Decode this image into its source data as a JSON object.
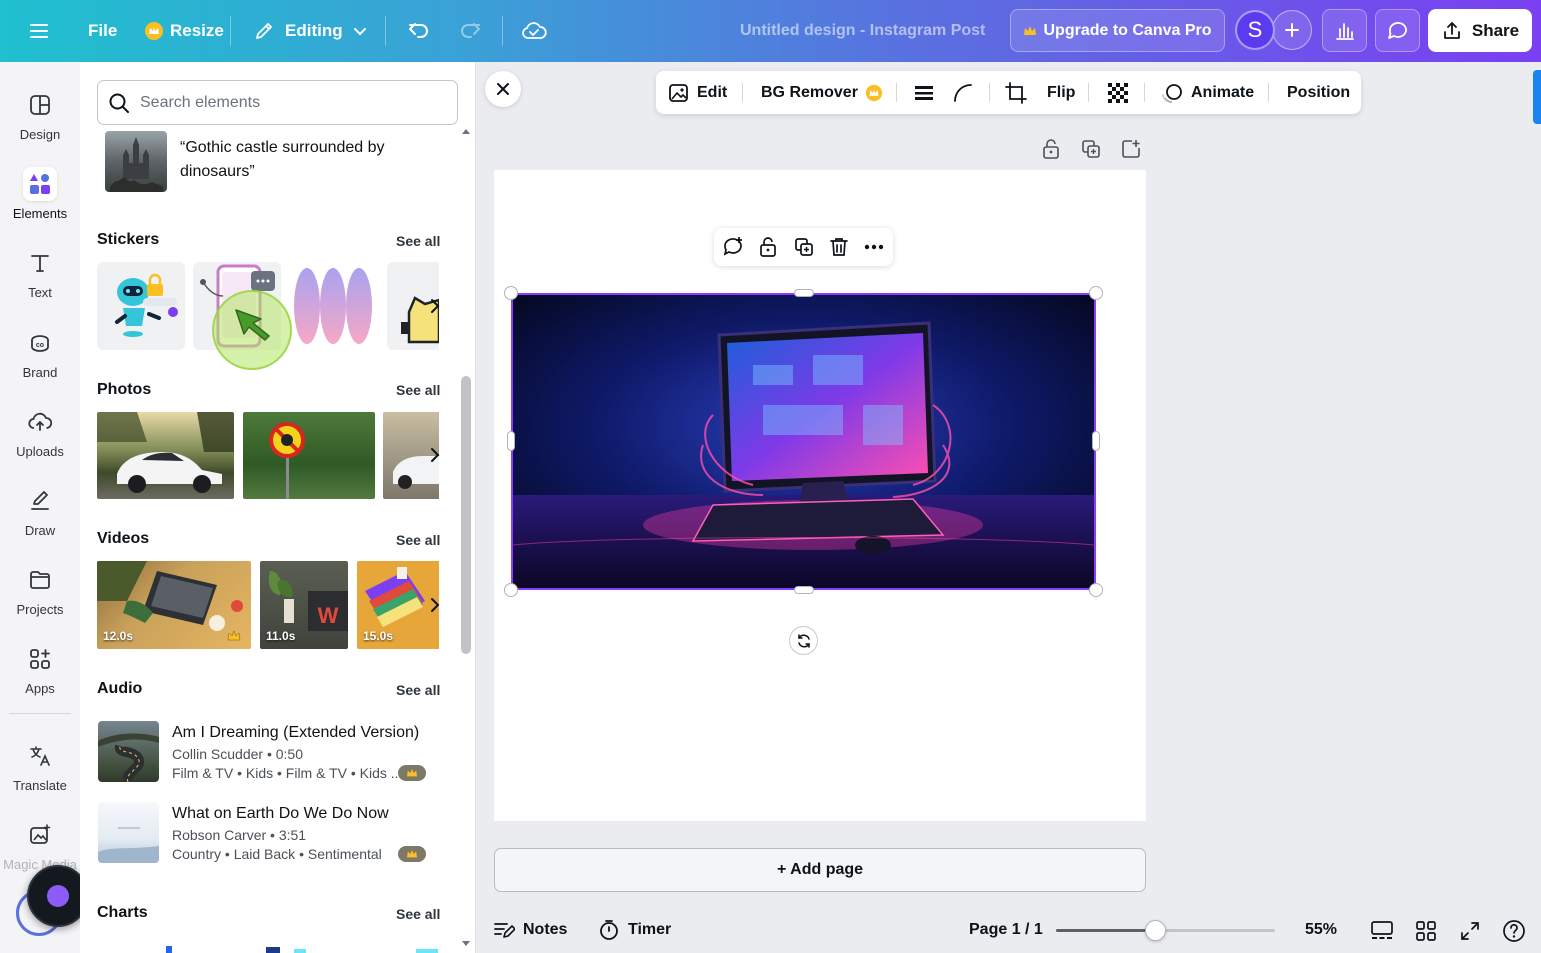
{
  "topbar": {
    "file_label": "File",
    "resize_label": "Resize",
    "editing_label": "Editing",
    "doc_title": "Untitled design - Instagram Post",
    "upgrade_label": "Upgrade to Canva Pro",
    "avatar_initial": "S",
    "share_label": "Share"
  },
  "rail": {
    "items": [
      {
        "label": "Design",
        "icon": "layout-icon"
      },
      {
        "label": "Elements",
        "icon": "shapes-icon"
      },
      {
        "label": "Text",
        "icon": "text-icon"
      },
      {
        "label": "Brand",
        "icon": "brand-icon"
      },
      {
        "label": "Uploads",
        "icon": "cloud-upload-icon"
      },
      {
        "label": "Draw",
        "icon": "pen-icon"
      },
      {
        "label": "Projects",
        "icon": "folder-icon"
      },
      {
        "label": "Apps",
        "icon": "apps-grid-icon"
      },
      {
        "label": "Translate",
        "icon": "translate-icon"
      },
      {
        "label": "Magic Media",
        "icon": "magic-media-icon"
      }
    ],
    "active": "Elements"
  },
  "panel": {
    "search_placeholder": "Search elements",
    "ai_suggestion_text": "“Gothic castle surrounded by dinosaurs”",
    "see_all": "See all",
    "sections": {
      "stickers": "Stickers",
      "photos": "Photos",
      "videos": "Videos",
      "audio": "Audio",
      "charts": "Charts"
    },
    "videos": [
      {
        "duration": "12.0s",
        "premium": true
      },
      {
        "duration": "11.0s",
        "premium": false
      },
      {
        "duration": "15.0s",
        "premium": false
      }
    ],
    "audio": [
      {
        "title": "Am I Dreaming (Extended Version)",
        "artist": "Collin Scudder • 0:50",
        "tags": "Film & TV • Kids • Film & TV • Kids ...",
        "premium": true
      },
      {
        "title": "What on Earth Do We Do Now",
        "artist": "Robson Carver • 3:51",
        "tags": "Country • Laid Back • Sentimental",
        "premium": true
      }
    ]
  },
  "context_toolbar": {
    "edit_label": "Edit",
    "bg_remover_label": "BG Remover",
    "flip_label": "Flip",
    "animate_label": "Animate",
    "position_label": "Position"
  },
  "canvas": {
    "add_page_label": "+ Add page"
  },
  "bottombar": {
    "notes_label": "Notes",
    "timer_label": "Timer",
    "page_indicator": "Page 1 / 1",
    "zoom_label": "55%",
    "zoom_value": 0.45
  },
  "colors": {
    "accent": "#8b3dff",
    "gradient_start": "#1fc0cf",
    "gradient_end": "#7b3ff2"
  }
}
